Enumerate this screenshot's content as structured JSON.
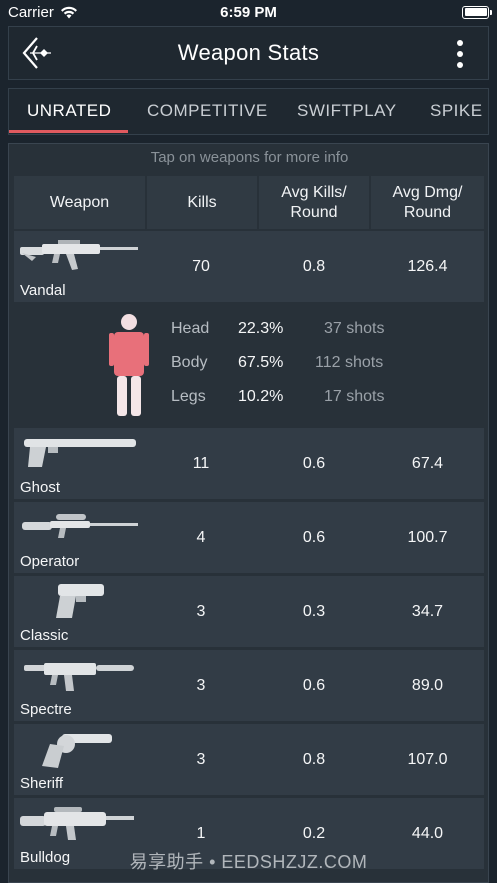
{
  "status_bar": {
    "carrier": "Carrier",
    "time": "6:59 PM"
  },
  "nav": {
    "title": "Weapon Stats"
  },
  "tabs": [
    {
      "label": "UNRATED",
      "active": true
    },
    {
      "label": "COMPETITIVE",
      "active": false
    },
    {
      "label": "SWIFTPLAY",
      "active": false
    },
    {
      "label": "SPIKE R",
      "active": false
    }
  ],
  "table": {
    "hint": "Tap on weapons for more info",
    "headers": {
      "weapon": "Weapon",
      "kills": "Kills",
      "avg_kills": "Avg Kills/\nRound",
      "avg_dmg": "Avg Dmg/\nRound"
    },
    "rows": [
      {
        "name": "Vandal",
        "kills": "70",
        "avg_kills": "0.8",
        "avg_dmg": "126.4",
        "icon": "vandal-rifle-icon"
      },
      {
        "name": "Ghost",
        "kills": "11",
        "avg_kills": "0.6",
        "avg_dmg": "67.4",
        "icon": "ghost-pistol-icon"
      },
      {
        "name": "Operator",
        "kills": "4",
        "avg_kills": "0.6",
        "avg_dmg": "100.7",
        "icon": "operator-sniper-icon"
      },
      {
        "name": "Classic",
        "kills": "3",
        "avg_kills": "0.3",
        "avg_dmg": "34.7",
        "icon": "classic-pistol-icon"
      },
      {
        "name": "Spectre",
        "kills": "3",
        "avg_kills": "0.6",
        "avg_dmg": "89.0",
        "icon": "spectre-smg-icon"
      },
      {
        "name": "Sheriff",
        "kills": "3",
        "avg_kills": "0.8",
        "avg_dmg": "107.0",
        "icon": "sheriff-revolver-icon"
      },
      {
        "name": "Bulldog",
        "kills": "1",
        "avg_kills": "0.2",
        "avg_dmg": "44.0",
        "icon": "bulldog-rifle-icon"
      }
    ]
  },
  "hit_breakdown": {
    "head": {
      "label": "Head",
      "pct": "22.3%",
      "shots": "37 shots"
    },
    "body": {
      "label": "Body",
      "pct": "67.5%",
      "shots": "112 shots"
    },
    "legs": {
      "label": "Legs",
      "pct": "10.2%",
      "shots": "17 shots"
    }
  },
  "colors": {
    "accent": "#e05a5f",
    "body_highlight": "#e8707a",
    "figure_base": "#f4e6e8"
  },
  "watermark": "易享助手 • EEDSHZJZ.COM"
}
